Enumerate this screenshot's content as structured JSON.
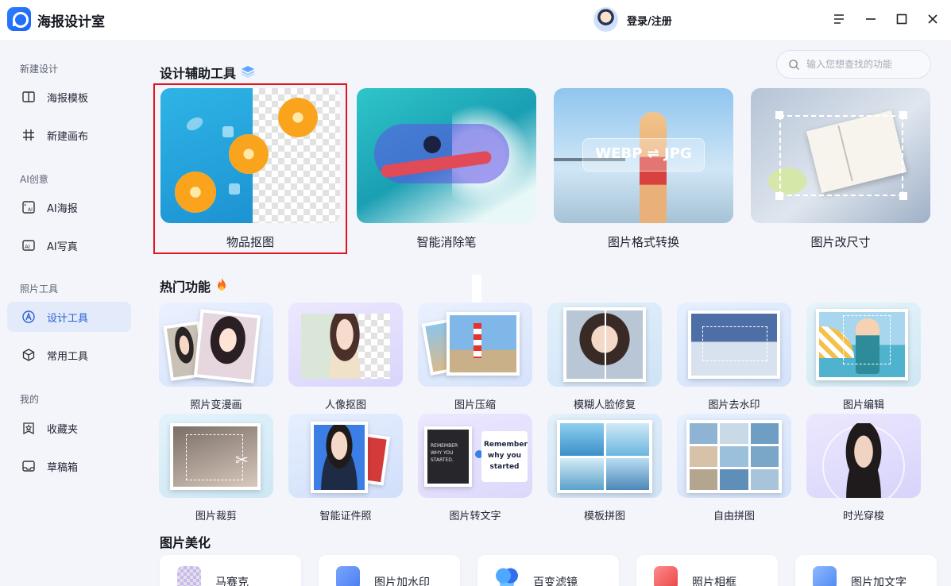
{
  "app": {
    "title": "海报设计室",
    "login": "登录/注册"
  },
  "window_controls": [
    "menu-icon",
    "minimize-icon",
    "maximize-icon",
    "close-icon"
  ],
  "sidebar": {
    "sections": [
      {
        "title": "新建设计",
        "items": [
          {
            "label": "海报模板",
            "icon": "poster-template-icon"
          },
          {
            "label": "新建画布",
            "icon": "canvas-grid-icon"
          }
        ]
      },
      {
        "title": "AI创意",
        "items": [
          {
            "label": "AI海报",
            "icon": "ai-poster-icon"
          },
          {
            "label": "AI写真",
            "icon": "ai-portrait-icon"
          }
        ]
      },
      {
        "title": "照片工具",
        "items": [
          {
            "label": "设计工具",
            "icon": "design-tool-icon",
            "active": true
          },
          {
            "label": "常用工具",
            "icon": "cube-icon"
          }
        ]
      },
      {
        "title": "我的",
        "items": [
          {
            "label": "收藏夹",
            "icon": "star-folder-icon"
          },
          {
            "label": "草稿箱",
            "icon": "draft-box-icon"
          }
        ]
      }
    ]
  },
  "search": {
    "placeholder": "输入您想查找的功能"
  },
  "design_tools": {
    "title": "设计辅助工具",
    "cards": [
      {
        "label": "物品抠图",
        "selected": true
      },
      {
        "label": "智能消除笔"
      },
      {
        "label": "图片格式转换",
        "badge": "WEBP ⇌ JPG"
      },
      {
        "label": "图片改尺寸"
      }
    ]
  },
  "hot": {
    "title": "热门功能",
    "cards": [
      {
        "label": "照片变漫画"
      },
      {
        "label": "人像抠图"
      },
      {
        "label": "图片压缩"
      },
      {
        "label": "模糊人脸修复"
      },
      {
        "label": "图片去水印"
      },
      {
        "label": "图片编辑"
      },
      {
        "label": "图片裁剪"
      },
      {
        "label": "智能证件照"
      },
      {
        "label": "图片转文字",
        "sample_text": "REMEMBER WHY YOU STARTED.",
        "sample_text_2": "Remember why you started"
      },
      {
        "label": "模板拼图"
      },
      {
        "label": "自由拼图"
      },
      {
        "label": "时光穿梭"
      }
    ]
  },
  "beautify": {
    "title": "图片美化",
    "cards": [
      {
        "label": "马赛克"
      },
      {
        "label": "图片加水印"
      },
      {
        "label": "百变滤镜"
      },
      {
        "label": "照片相框"
      },
      {
        "label": "图片加文字"
      }
    ]
  },
  "colors": {
    "accent": "#2c5fd6",
    "highlight": "#e0141a",
    "background": "#f3f5fb"
  }
}
